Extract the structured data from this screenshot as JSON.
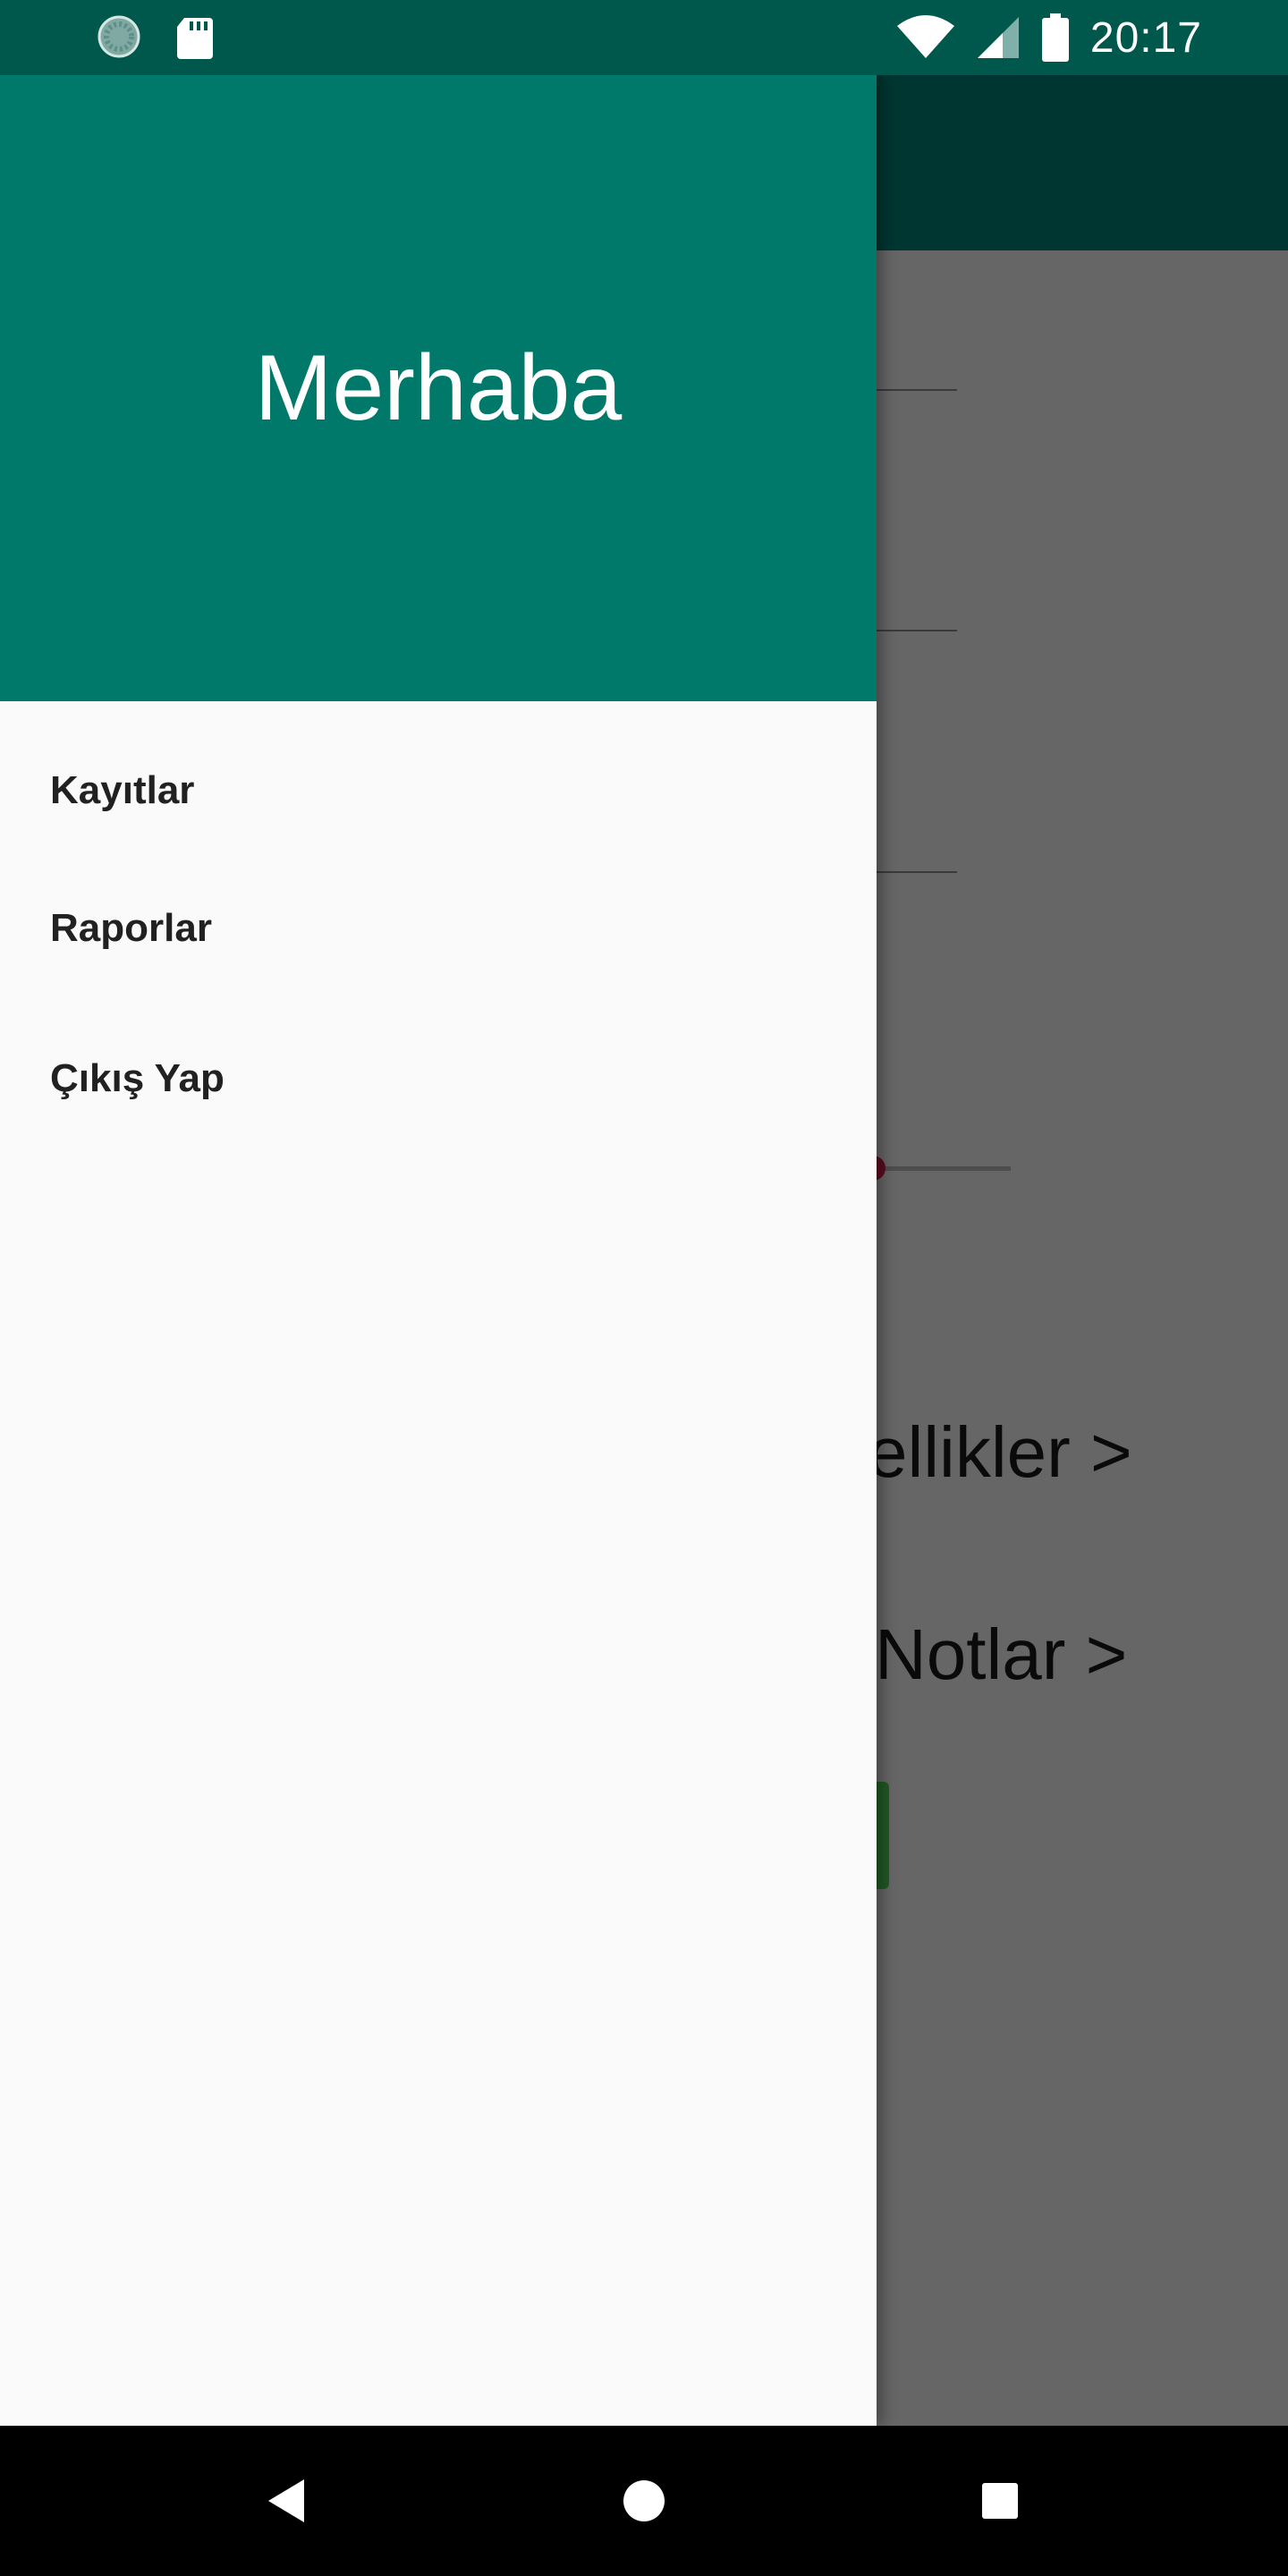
{
  "status_bar": {
    "time": "20:17",
    "left_icons": [
      "sync-icon",
      "sd-card-icon"
    ],
    "right_icons": [
      "wifi-icon",
      "signal-icon",
      "battery-icon"
    ],
    "background_color": "#00574b"
  },
  "drawer": {
    "header_title": "Merhaba",
    "header_color": "#00796b",
    "items": [
      {
        "label": "Kayıtlar"
      },
      {
        "label": "Raporlar"
      },
      {
        "label": "Çıkış Yap"
      }
    ]
  },
  "background_screen": {
    "toolbar_color": "#003631",
    "links": [
      {
        "label": "zellikler >"
      },
      {
        "label": "Notlar >"
      }
    ]
  },
  "nav_bar": {
    "buttons": [
      "back-icon",
      "home-icon",
      "recents-icon"
    ]
  }
}
